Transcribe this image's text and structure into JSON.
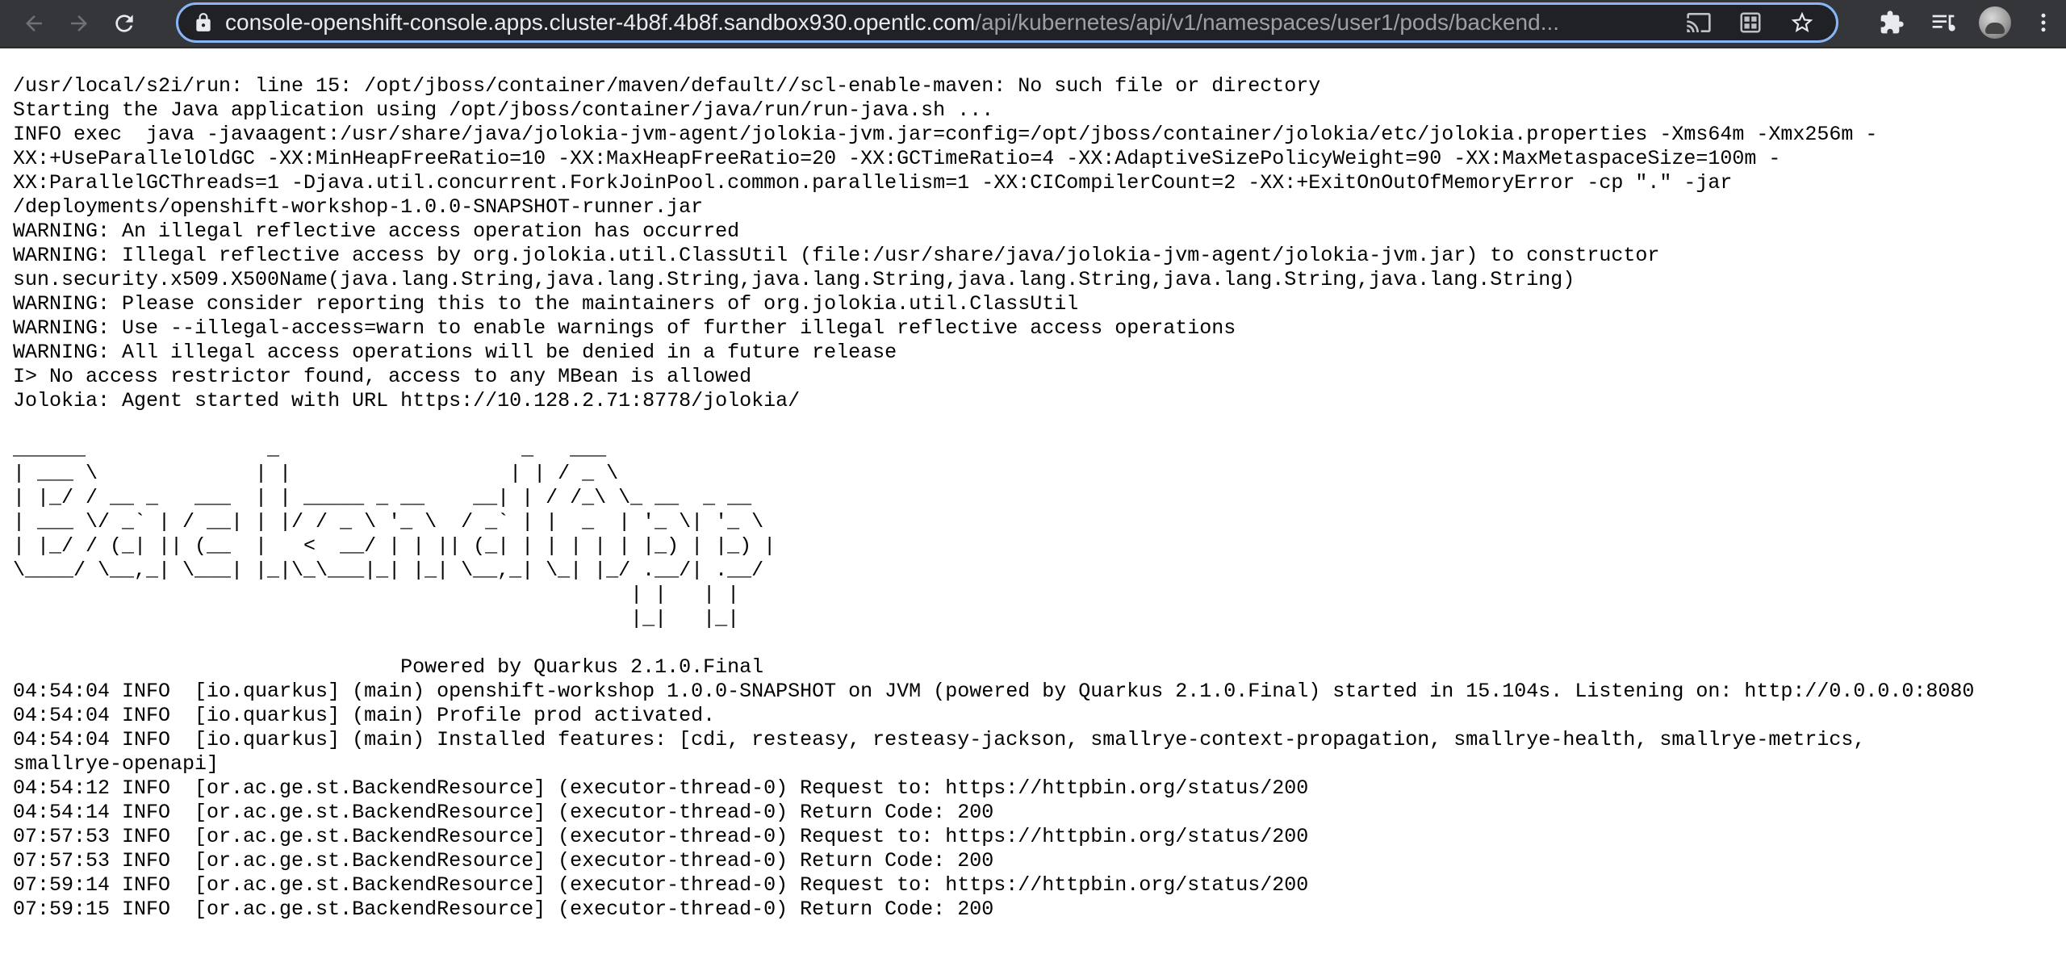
{
  "browser": {
    "url_host": "console-openshift-console.apps.cluster-4b8f.4b8f.sandbox930.opentlc.com",
    "url_path": "/api/kubernetes/api/v1/namespaces/user1/pods/backend...",
    "icons": [
      "back-icon",
      "forward-icon",
      "reload-icon",
      "lock-icon",
      "cast-icon",
      "install-app-icon",
      "bookmark-star-icon",
      "extensions-icon",
      "reading-list-icon",
      "profile-avatar",
      "more-menu-icon"
    ]
  },
  "log": {
    "lines": [
      "/usr/local/s2i/run: line 15: /opt/jboss/container/maven/default//scl-enable-maven: No such file or directory",
      "Starting the Java application using /opt/jboss/container/java/run/run-java.sh ...",
      "INFO exec  java -javaagent:/usr/share/java/jolokia-jvm-agent/jolokia-jvm.jar=config=/opt/jboss/container/jolokia/etc/jolokia.properties -Xms64m -Xmx256m -",
      "XX:+UseParallelOldGC -XX:MinHeapFreeRatio=10 -XX:MaxHeapFreeRatio=20 -XX:GCTimeRatio=4 -XX:AdaptiveSizePolicyWeight=90 -XX:MaxMetaspaceSize=100m -",
      "XX:ParallelGCThreads=1 -Djava.util.concurrent.ForkJoinPool.common.parallelism=1 -XX:CICompilerCount=2 -XX:+ExitOnOutOfMemoryError -cp \".\" -jar",
      "/deployments/openshift-workshop-1.0.0-SNAPSHOT-runner.jar",
      "WARNING: An illegal reflective access operation has occurred",
      "WARNING: Illegal reflective access by org.jolokia.util.ClassUtil (file:/usr/share/java/jolokia-jvm-agent/jolokia-jvm.jar) to constructor",
      "sun.security.x509.X500Name(java.lang.String,java.lang.String,java.lang.String,java.lang.String,java.lang.String,java.lang.String)",
      "WARNING: Please consider reporting this to the maintainers of org.jolokia.util.ClassUtil",
      "WARNING: Use --illegal-access=warn to enable warnings of further illegal reflective access operations",
      "WARNING: All illegal access operations will be denied in a future release",
      "I> No access restrictor found, access to any MBean is allowed",
      "Jolokia: Agent started with URL https://10.128.2.71:8778/jolokia/",
      "",
      "______               _                    _   ___",
      "| ___ \\             | |                  | | / _ \\",
      "| |_/ / __ _   ___  | | _____ _ __    __| | / /_\\ \\_ __  _ __",
      "| ___ \\/ _` | / __| | |/ / _ \\ '_ \\  / _` | |  _  | '_ \\| '_ \\",
      "| |_/ / (_| || (__  |   <  __/ | | || (_| | | | | | |_) | |_) |",
      "\\____/ \\__,_| \\___| |_|\\_\\___|_| |_| \\__,_| \\_| |_/ .__/| .__/",
      "                                                   | |   | |",
      "                                                   |_|   |_|",
      "",
      "                                Powered by Quarkus 2.1.0.Final",
      "04:54:04 INFO  [io.quarkus] (main) openshift-workshop 1.0.0-SNAPSHOT on JVM (powered by Quarkus 2.1.0.Final) started in 15.104s. Listening on: http://0.0.0.0:8080",
      "04:54:04 INFO  [io.quarkus] (main) Profile prod activated.",
      "04:54:04 INFO  [io.quarkus] (main) Installed features: [cdi, resteasy, resteasy-jackson, smallrye-context-propagation, smallrye-health, smallrye-metrics,",
      "smallrye-openapi]",
      "04:54:12 INFO  [or.ac.ge.st.BackendResource] (executor-thread-0) Request to: https://httpbin.org/status/200",
      "04:54:14 INFO  [or.ac.ge.st.BackendResource] (executor-thread-0) Return Code: 200",
      "07:57:53 INFO  [or.ac.ge.st.BackendResource] (executor-thread-0) Request to: https://httpbin.org/status/200",
      "07:57:53 INFO  [or.ac.ge.st.BackendResource] (executor-thread-0) Return Code: 200",
      "07:59:14 INFO  [or.ac.ge.st.BackendResource] (executor-thread-0) Request to: https://httpbin.org/status/200",
      "07:59:15 INFO  [or.ac.ge.st.BackendResource] (executor-thread-0) Return Code: 200"
    ]
  },
  "colors": {
    "toolbar_bg": "#35363a",
    "omnibox_bg": "#202124",
    "omnibox_focus_ring": "#8ab4f8",
    "url_host": "#e8eaed",
    "url_path": "#9aa0a6",
    "page_bg": "#ffffff",
    "log_text": "#000000"
  }
}
